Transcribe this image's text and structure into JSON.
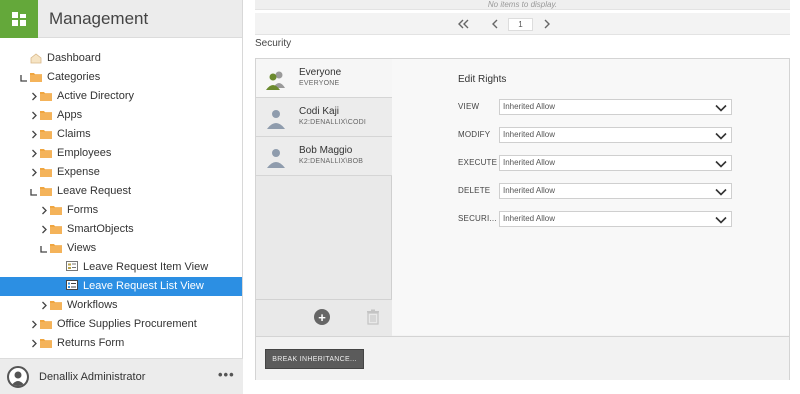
{
  "app": {
    "title": "Management"
  },
  "tree": [
    {
      "label": "Dashboard",
      "depth": 0,
      "icon": "dashboard-icon",
      "twisty": "none"
    },
    {
      "label": "Categories",
      "depth": 0,
      "icon": "folder-icon",
      "twisty": "expanded"
    },
    {
      "label": "Active Directory",
      "depth": 1,
      "icon": "folder-icon",
      "twisty": "collapsed"
    },
    {
      "label": "Apps",
      "depth": 1,
      "icon": "folder-icon",
      "twisty": "collapsed"
    },
    {
      "label": "Claims",
      "depth": 1,
      "icon": "folder-icon",
      "twisty": "collapsed"
    },
    {
      "label": "Employees",
      "depth": 1,
      "icon": "folder-icon",
      "twisty": "collapsed"
    },
    {
      "label": "Expense",
      "depth": 1,
      "icon": "folder-icon",
      "twisty": "collapsed"
    },
    {
      "label": "Leave Request",
      "depth": 1,
      "icon": "folder-icon",
      "twisty": "expanded"
    },
    {
      "label": "Forms",
      "depth": 2,
      "icon": "folder-icon",
      "twisty": "collapsed"
    },
    {
      "label": "SmartObjects",
      "depth": 2,
      "icon": "folder-icon",
      "twisty": "collapsed"
    },
    {
      "label": "Views",
      "depth": 2,
      "icon": "folder-icon",
      "twisty": "expanded"
    },
    {
      "label": "Leave Request Item View",
      "depth": 3,
      "icon": "item-view-icon",
      "twisty": "none"
    },
    {
      "label": "Leave Request List View",
      "depth": 3,
      "icon": "list-view-icon",
      "twisty": "none",
      "selected": true
    },
    {
      "label": "Workflows",
      "depth": 2,
      "icon": "folder-icon",
      "twisty": "collapsed"
    },
    {
      "label": "Office Supplies Procurement",
      "depth": 1,
      "icon": "folder-icon",
      "twisty": "collapsed"
    },
    {
      "label": "Returns Form",
      "depth": 1,
      "icon": "folder-icon",
      "twisty": "collapsed"
    }
  ],
  "footer": {
    "user_name": "Denallix Administrator",
    "more": "•••"
  },
  "list_view": {
    "empty_text": "No items to display.",
    "page_number": "1"
  },
  "security": {
    "heading": "Security",
    "users": [
      {
        "name": "Everyone",
        "sub": "EVERYONE",
        "icon": "group-icon"
      },
      {
        "name": "Codi Kaji",
        "sub": "K2:DENALLIX\\CODI",
        "icon": "user-icon"
      },
      {
        "name": "Bob Maggio",
        "sub": "K2:DENALLIX\\BOB",
        "icon": "user-icon"
      }
    ],
    "edit_rights_title": "Edit Rights",
    "rights": [
      {
        "label": "VIEW",
        "value": "Inherited Allow"
      },
      {
        "label": "MODIFY",
        "value": "Inherited Allow"
      },
      {
        "label": "EXECUTE",
        "value": "Inherited Allow"
      },
      {
        "label": "DELETE",
        "value": "Inherited Allow"
      },
      {
        "label": "SECURI...",
        "value": "Inherited Allow"
      }
    ],
    "break_button": "BREAK INHERITANCE..."
  },
  "colors": {
    "brand": "#64a83a",
    "selected": "#2c8fe3",
    "folder": "#f0a640"
  }
}
